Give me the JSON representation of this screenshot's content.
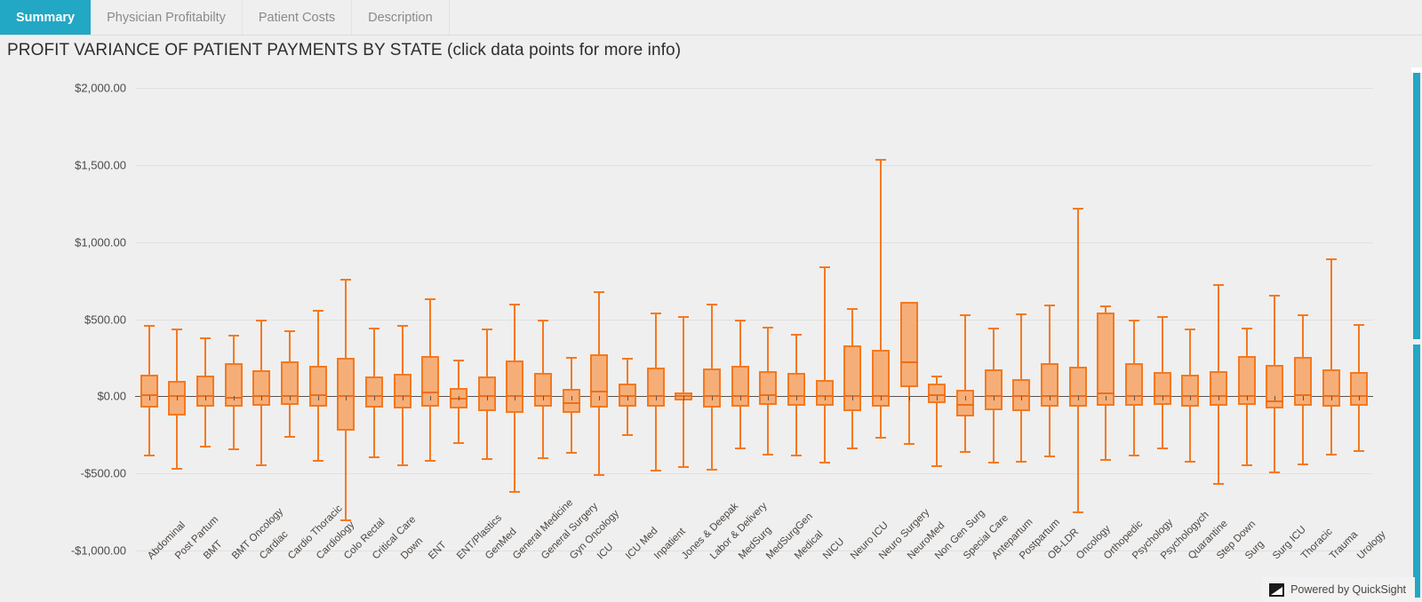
{
  "tabs": [
    {
      "label": "Summary",
      "active": true
    },
    {
      "label": "Physician Profitabilty",
      "active": false
    },
    {
      "label": "Patient Costs",
      "active": false
    },
    {
      "label": "Description",
      "active": false
    }
  ],
  "viz": {
    "title": "PROFIT VARIANCE OF PATIENT PAYMENTS BY STATE (click data points for more info)"
  },
  "badge": {
    "text": "Powered by QuickSight",
    "icon": "quicksight-logo-icon"
  },
  "colors": {
    "accent_teal": "#22A7C4",
    "box_fill": "#F6AE78",
    "box_stroke": "#F47920",
    "median": "#ED6E19",
    "axis": "#5A5450",
    "grid": "#E0E0E0",
    "background": "#EFEFEF"
  },
  "chart_data": {
    "type": "boxplot",
    "title": "PROFIT VARIANCE OF PATIENT PAYMENTS BY STATE (click data points for more info)",
    "xlabel": "",
    "ylabel": "",
    "ylim": [
      -1000,
      2000
    ],
    "ytick_labels": [
      "$2,000.00",
      "$1,500.00",
      "$1,000.00",
      "$500.00",
      "$0.00",
      "-$500.00",
      "-$1,000.00"
    ],
    "ytick_values": [
      2000,
      1500,
      1000,
      500,
      0,
      -500,
      -1000
    ],
    "grid": true,
    "legend": "none",
    "categories": [
      "Abdominal",
      "Post Partum",
      "BMT",
      "BMT Oncology",
      "Cardiac",
      "Cardio Thoracic",
      "Cardiology",
      "Colo Rectal",
      "Critical Care",
      "Down",
      "ENT",
      "ENT/Plastics",
      "GenMed",
      "General Medicine",
      "General Surgery",
      "Gyn Oncology",
      "ICU",
      "ICU Med",
      "Inpatient",
      "Jones & Deepak",
      "Labor & Delivery",
      "MedSurg",
      "MedSurgGen",
      "Medical",
      "NICU",
      "Neuro ICU",
      "Neuro Surgery",
      "NeuroMed",
      "Non Gen Surg",
      "Special Care",
      "Antepartum",
      "Postpartum",
      "OB-LDR",
      "Oncology",
      "Orthopedic",
      "Psychology",
      "Psychologych",
      "Quarantine",
      "Step Down",
      "Surg",
      "Surg ICU",
      "Thoracic",
      "Trauma",
      "Urology"
    ],
    "boxes": [
      {
        "category": "Abdominal",
        "min": -380,
        "q1": -75,
        "median": 15,
        "q3": 140,
        "max": 460
      },
      {
        "category": "Post Partum",
        "min": -465,
        "q1": -125,
        "median": 10,
        "q3": 100,
        "max": 440
      },
      {
        "category": "BMT",
        "min": -320,
        "q1": -70,
        "median": 5,
        "q3": 135,
        "max": 380
      },
      {
        "category": "BMT Oncology",
        "min": -335,
        "q1": -65,
        "median": -5,
        "q3": 215,
        "max": 400
      },
      {
        "category": "Cardiac",
        "min": -440,
        "q1": -60,
        "median": 10,
        "q3": 170,
        "max": 495
      },
      {
        "category": "Cardio Thoracic",
        "min": -255,
        "q1": -55,
        "median": 8,
        "q3": 225,
        "max": 430
      },
      {
        "category": "Cardiology",
        "min": -410,
        "q1": -70,
        "median": 12,
        "q3": 200,
        "max": 560
      },
      {
        "category": "Colo Rectal",
        "min": -800,
        "q1": -220,
        "median": 10,
        "q3": 250,
        "max": 760
      },
      {
        "category": "Critical Care",
        "min": -390,
        "q1": -75,
        "median": 5,
        "q3": 130,
        "max": 445
      },
      {
        "category": "Down",
        "min": -440,
        "q1": -80,
        "median": 8,
        "q3": 145,
        "max": 460
      },
      {
        "category": "ENT",
        "min": -415,
        "q1": -65,
        "median": 30,
        "q3": 260,
        "max": 635
      },
      {
        "category": "ENT/Plastics",
        "min": -300,
        "q1": -80,
        "median": -8,
        "q3": 55,
        "max": 240
      },
      {
        "category": "GenMed",
        "min": -400,
        "q1": -95,
        "median": 5,
        "q3": 130,
        "max": 440
      },
      {
        "category": "General Medicine",
        "min": -615,
        "q1": -105,
        "median": 5,
        "q3": 230,
        "max": 600
      },
      {
        "category": "General Surgery",
        "min": -395,
        "q1": -65,
        "median": 8,
        "q3": 150,
        "max": 500
      },
      {
        "category": "Gyn Oncology",
        "min": -360,
        "q1": -110,
        "median": -40,
        "q3": 50,
        "max": 255
      },
      {
        "category": "ICU",
        "min": -505,
        "q1": -75,
        "median": 35,
        "q3": 270,
        "max": 680
      },
      {
        "category": "ICU Med",
        "min": -245,
        "q1": -70,
        "median": 5,
        "q3": 85,
        "max": 250
      },
      {
        "category": "Inpatient",
        "min": -475,
        "q1": -70,
        "median": 10,
        "q3": 185,
        "max": 545
      },
      {
        "category": "Jones & Deepak",
        "min": -455,
        "q1": -25,
        "median": 5,
        "q3": 25,
        "max": 520
      },
      {
        "category": "Labor & Delivery",
        "min": -470,
        "q1": -75,
        "median": 8,
        "q3": 180,
        "max": 600
      },
      {
        "category": "MedSurg",
        "min": -330,
        "q1": -70,
        "median": 10,
        "q3": 195,
        "max": 500
      },
      {
        "category": "MedSurgGen",
        "min": -370,
        "q1": -55,
        "median": 15,
        "q3": 165,
        "max": 450
      },
      {
        "category": "Medical",
        "min": -380,
        "q1": -60,
        "median": 8,
        "q3": 150,
        "max": 405
      },
      {
        "category": "NICU",
        "min": -425,
        "q1": -60,
        "median": 5,
        "q3": 105,
        "max": 840
      },
      {
        "category": "Neuro ICU",
        "min": -330,
        "q1": -95,
        "median": 8,
        "q3": 330,
        "max": 570
      },
      {
        "category": "Neuro Surgery",
        "min": -265,
        "q1": -65,
        "median": 5,
        "q3": 300,
        "max": 1540
      },
      {
        "category": "NeuroMed",
        "min": -305,
        "q1": 60,
        "median": 225,
        "q3": 615,
        "max": 615
      },
      {
        "category": "Non Gen Surg",
        "min": -450,
        "q1": -45,
        "median": 12,
        "q3": 80,
        "max": 135
      },
      {
        "category": "Special Care",
        "min": -355,
        "q1": -130,
        "median": -50,
        "q3": 45,
        "max": 530
      },
      {
        "category": "Antepartum",
        "min": -425,
        "q1": -90,
        "median": 5,
        "q3": 175,
        "max": 445
      },
      {
        "category": "Postpartum",
        "min": -420,
        "q1": -95,
        "median": 8,
        "q3": 110,
        "max": 540
      },
      {
        "category": "OB-LDR",
        "min": -385,
        "q1": -65,
        "median": 10,
        "q3": 215,
        "max": 595
      },
      {
        "category": "Oncology",
        "min": -745,
        "q1": -70,
        "median": 5,
        "q3": 190,
        "max": 1220
      },
      {
        "category": "Orthopedic",
        "min": -405,
        "q1": -60,
        "median": 25,
        "q3": 545,
        "max": 590
      },
      {
        "category": "Psychology",
        "min": -380,
        "q1": -60,
        "median": 5,
        "q3": 215,
        "max": 495
      },
      {
        "category": "Psychologych",
        "min": -330,
        "q1": -55,
        "median": 8,
        "q3": 155,
        "max": 520
      },
      {
        "category": "Quarantine",
        "min": -420,
        "q1": -65,
        "median": 5,
        "q3": 140,
        "max": 440
      },
      {
        "category": "Step Down",
        "min": -560,
        "q1": -60,
        "median": 10,
        "q3": 165,
        "max": 725
      },
      {
        "category": "Surg",
        "min": -440,
        "q1": -55,
        "median": 8,
        "q3": 260,
        "max": 445
      },
      {
        "category": "Surg ICU",
        "min": -485,
        "q1": -80,
        "median": -25,
        "q3": 205,
        "max": 660
      },
      {
        "category": "Thoracic",
        "min": -435,
        "q1": -60,
        "median": 12,
        "q3": 255,
        "max": 530
      },
      {
        "category": "Trauma",
        "min": -375,
        "q1": -70,
        "median": 5,
        "q3": 175,
        "max": 895
      },
      {
        "category": "Urology",
        "min": -350,
        "q1": -60,
        "median": 8,
        "q3": 160,
        "max": 470
      }
    ]
  }
}
